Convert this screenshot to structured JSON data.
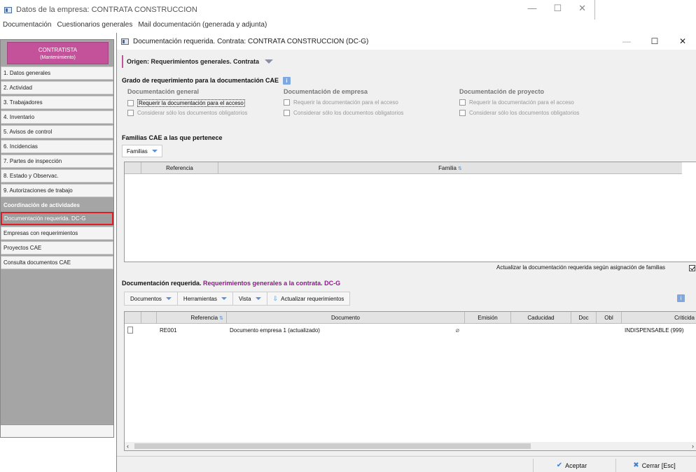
{
  "bg_window": {
    "title": "Datos de la empresa: CONTRATA CONSTRUCCION",
    "menu": [
      "Documentación",
      "Cuestionarios generales",
      "Mail documentación (generada y adjunta)"
    ]
  },
  "sidebar": {
    "header_title": "CONTRATISTA",
    "header_sub": "(Mantenimiento)",
    "items": [
      {
        "label": "1. Datos generales"
      },
      {
        "label": "2. Actividad"
      },
      {
        "label": "3. Trabajadores"
      },
      {
        "label": "4. Inventario"
      },
      {
        "label": "5. Avisos de control"
      },
      {
        "label": "6. Incidencias"
      },
      {
        "label": "7. Partes de inspección"
      },
      {
        "label": "8. Estado y Observac."
      },
      {
        "label": "9. Autorizaciones de trabajo"
      }
    ],
    "section_label": "Coordinación de actividades",
    "sub_items": [
      {
        "label": "Documentación requerida. DC-G"
      },
      {
        "label": "Empresas con requerimientos"
      },
      {
        "label": "Proyectos CAE"
      },
      {
        "label": "Consulta documentos CAE"
      }
    ]
  },
  "dialog": {
    "title": "Documentación requerida. Contrata: CONTRATA CONSTRUCCION (DC-G)",
    "origin": "Origen: Requerimientos generales. Contrata",
    "grado_title": "Grado de requerimiento para la documentación CAE",
    "columns": [
      {
        "title": "Documentación general",
        "opt1": "Requerir la documentación para el acceso",
        "opt2": "Considerar sólo los documentos obligatorios"
      },
      {
        "title": "Documentación de empresa",
        "opt1": "Requerir la documentación para el acceso",
        "opt2": "Considerar sólo los documentos obligatorios"
      },
      {
        "title": "Documentación de proyecto",
        "opt1": "Requerir la documentación para el acceso",
        "opt2": "Considerar sólo los documentos obligatorios"
      }
    ],
    "familias_title": "Familias CAE a las que pertenece",
    "familias_btn": "Familias",
    "familias_grid": {
      "col_ref": "Referencia",
      "col_familia": "Familia"
    },
    "actualizar_text": "Actualizar la documentación requerida según asignación de familias",
    "docreq_title_a": "Documentación requerida.",
    "docreq_title_b": "Requerimientos generales a la contrata. DC-G",
    "toolbar": {
      "documentos": "Documentos",
      "herramientas": "Herramientas",
      "vista": "Vista",
      "actualizar": "Actualizar requerimientos"
    },
    "docs_grid": {
      "headers": {
        "referencia": "Referencia",
        "documento": "Documento",
        "emision": "Emisión",
        "caducidad": "Caducidad",
        "doc": "Doc",
        "obl": "Obl",
        "criticidad": "Criticida"
      },
      "rows": [
        {
          "referencia": "RE001",
          "documento": "Documento empresa 1 (actualizado)",
          "criticidad": "INDISPENSABLE (999)"
        }
      ]
    },
    "buttons": {
      "aceptar": "Aceptar",
      "cerrar": "Cerrar [Esc]"
    }
  }
}
